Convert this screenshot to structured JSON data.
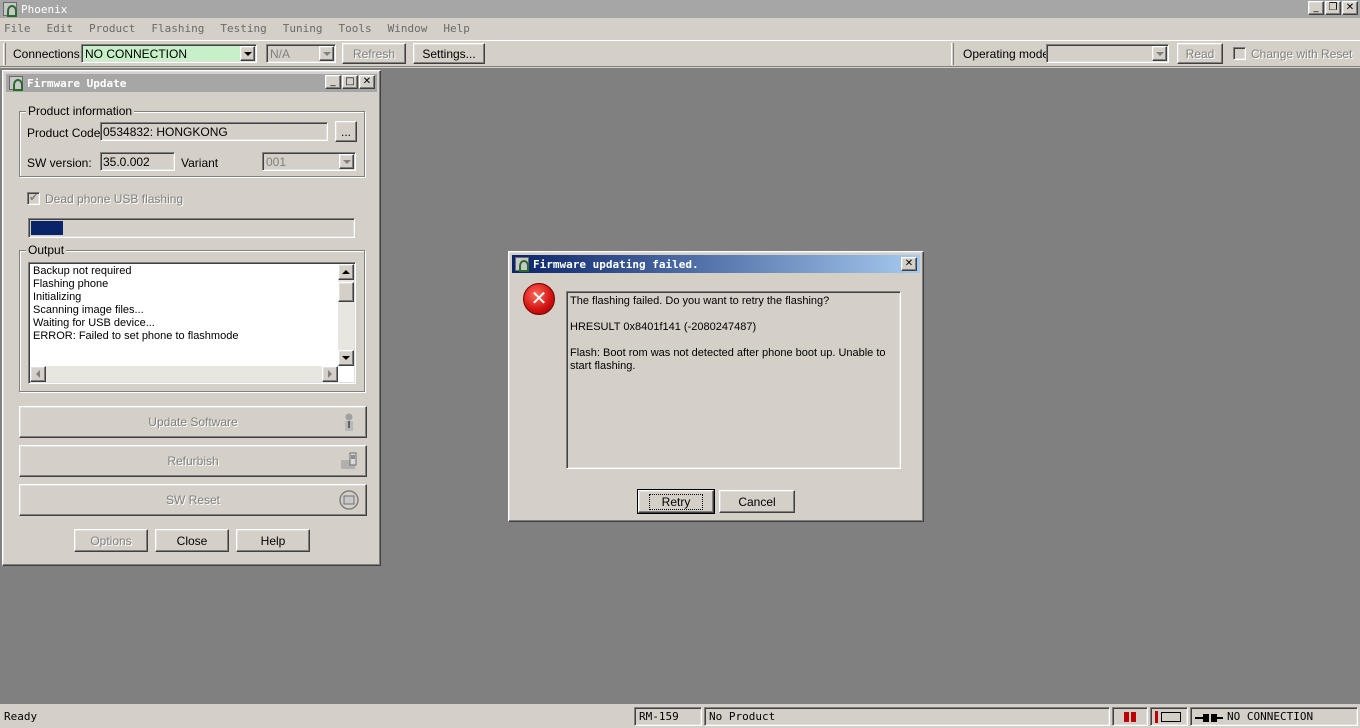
{
  "app": {
    "title": "Phoenix"
  },
  "menu": [
    "File",
    "Edit",
    "Product",
    "Flashing",
    "Testing",
    "Tuning",
    "Tools",
    "Window",
    "Help"
  ],
  "toolbar": {
    "connections_label": "Connections:",
    "connection_value": "NO CONNECTION",
    "port_value": "N/A",
    "refresh_label": "Refresh",
    "settings_label": "Settings...",
    "operating_mode_label": "Operating mode:",
    "operating_mode_value": "",
    "read_label": "Read",
    "change_with_reset_label": "Change with Reset"
  },
  "firmware": {
    "title": "Firmware Update",
    "product_info_label": "Product information",
    "product_code_label": "Product Code:",
    "product_code_value": "0534832: HONGKONG",
    "browse_label": "...",
    "sw_version_label": "SW version:",
    "sw_version_value": "35.0.002",
    "variant_label": "Variant",
    "variant_value": "001",
    "dead_phone_label": "Dead phone USB flashing",
    "dead_phone_checked": true,
    "progress_fraction": 0.1,
    "output_label": "Output",
    "output_lines": [
      "Backup not required",
      "Flashing phone",
      "Initializing",
      "Scanning image files...",
      "Waiting for USB device...",
      "ERROR: Failed to set phone to flashmode"
    ],
    "update_label": "Update Software",
    "refurbish_label": "Refurbish",
    "sw_reset_label": "SW Reset",
    "options_label": "Options",
    "close_label": "Close",
    "help_label": "Help"
  },
  "dialog": {
    "title": "Firmware updating failed.",
    "line1": "The flashing failed. Do you want to retry the flashing?",
    "line2": "HRESULT 0x8401f141 (-2080247487)",
    "line3": "Flash: Boot rom was not detected after phone boot up. Unable to start flashing.",
    "retry_label": "Retry",
    "cancel_label": "Cancel"
  },
  "status": {
    "ready": "Ready",
    "model": "RM-159",
    "product": "No Product",
    "connection": "NO CONNECTION"
  },
  "colors": {
    "connection_field_bg": "#c8f0c8",
    "progress_fill": "#0a246a",
    "active_title": "#0a246a",
    "error_red": "#d01010"
  }
}
